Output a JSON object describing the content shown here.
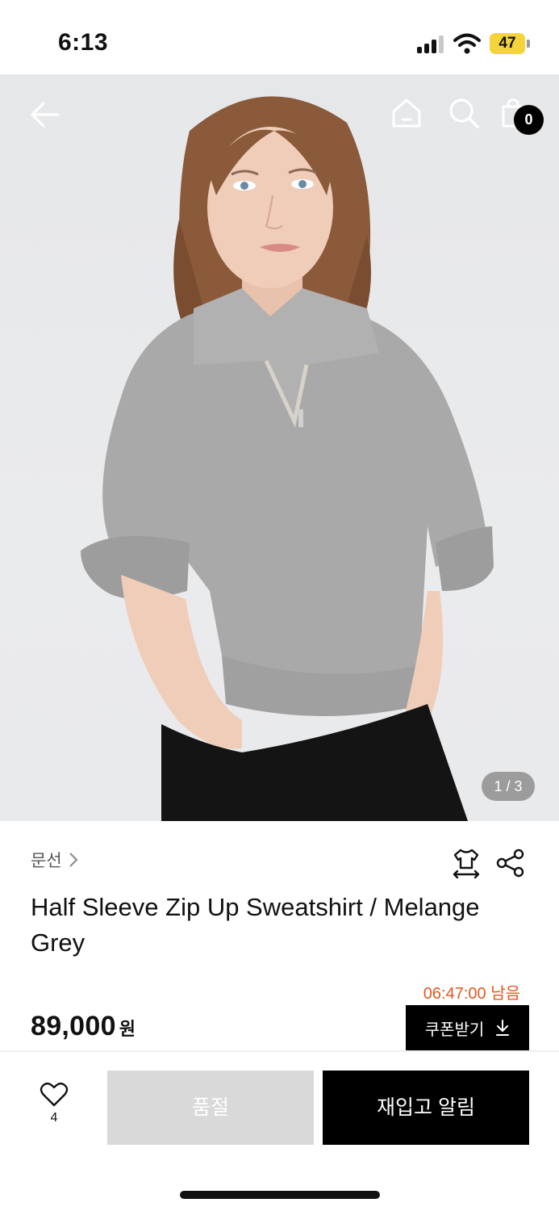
{
  "status_bar": {
    "time": "6:13",
    "battery": "47"
  },
  "header": {
    "icons": [
      "back-arrow-icon",
      "home-icon",
      "search-icon",
      "shopping-bag-icon"
    ],
    "cart_count": "0"
  },
  "gallery": {
    "indicator": "1 / 3"
  },
  "product": {
    "brand": "문선",
    "title": "Half Sleeve Zip Up Sweatshirt / Melange Grey",
    "countdown": "06:47:00 남음",
    "price": "89,000",
    "currency": "원",
    "coupon_label": "쿠폰받기"
  },
  "actions": {
    "like_count": "4",
    "soldout_label": "품절",
    "restock_label": "재입고 알림"
  },
  "colors": {
    "accent_countdown": "#e5571e",
    "primary": "#000000",
    "disabled": "#d9d9d9"
  }
}
